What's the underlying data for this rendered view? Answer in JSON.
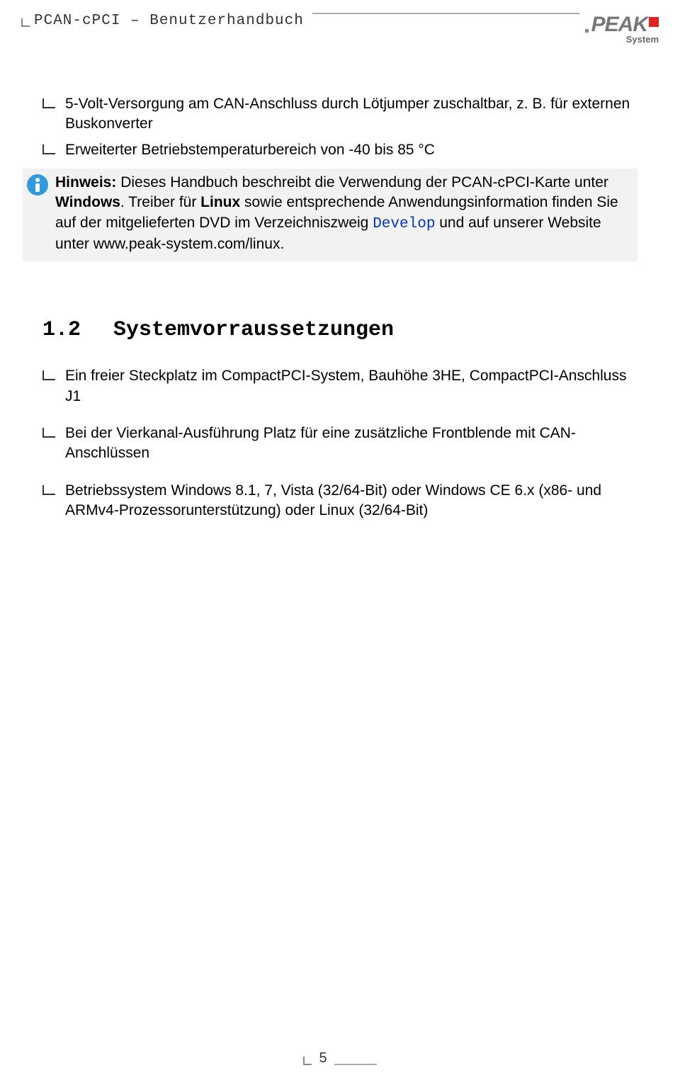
{
  "header": {
    "title": "PCAN-cPCI – Benutzerhandbuch",
    "logoText": "PEAK",
    "logoSub": "System"
  },
  "list1": {
    "items": [
      "5-Volt-Versorgung am CAN-Anschluss durch Lötjumper zuschaltbar, z. B. für externen Buskonverter",
      "Erweiterter Betriebstemperaturbereich von -40 bis 85 °C"
    ]
  },
  "note": {
    "label": "Hinweis:",
    "part1": " Dieses Handbuch beschreibt die Verwendung der PCAN-cPCI-Karte unter ",
    "bold1": "Windows",
    "part2": ". Treiber für ",
    "bold2": "Linux",
    "part3": " sowie entsprechende Anwendungsinformation finden Sie auf der mitgelieferten DVD im Verzeichniszweig ",
    "mono": "Develop",
    "part4": " und auf unserer Website unter www.peak-system.com/linux."
  },
  "section": {
    "number": "1.2",
    "title": "Systemvorraussetzungen"
  },
  "list2": {
    "items": [
      "Ein freier Steckplatz im CompactPCI-System, Bauhöhe 3HE, CompactPCI-Anschluss J1",
      "Bei der Vierkanal-Ausführung Platz für eine zusätzliche Frontblende mit CAN-Anschlüssen",
      "Betriebssystem Windows 8.1, 7, Vista (32/64-Bit) oder Windows CE 6.x (x86- und ARMv4-Prozessorunterstützung) oder Linux (32/64-Bit)"
    ]
  },
  "footer": {
    "pageNumber": "5"
  }
}
